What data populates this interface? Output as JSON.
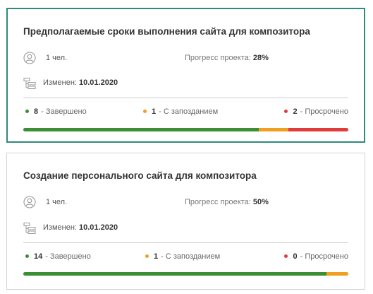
{
  "colors": {
    "done": "#3a8f35",
    "late": "#f0a020",
    "overdue": "#e03c3c",
    "accent_border": "#2e8b79"
  },
  "labels": {
    "progress": "Прогресс проекта:",
    "changed": "Изменен:",
    "done": "- Завершено",
    "late": "- С запозданием",
    "overdue": "- Просрочено"
  },
  "cards": [
    {
      "title": "Предполагаемые сроки выполнения сайта для композитора",
      "members": "1 чел.",
      "progress": "28%",
      "changed_date": "10.01.2020",
      "done_count": "8",
      "late_count": "1",
      "overdue_count": "2",
      "selected": true,
      "bar_fractions": {
        "done": 0.725,
        "late": 0.09,
        "overdue": 0.185
      }
    },
    {
      "title": "Создание персонального сайта для композитора",
      "members": "1 чел.",
      "progress": "50%",
      "changed_date": "10.01.2020",
      "done_count": "14",
      "late_count": "1",
      "overdue_count": "0",
      "selected": false,
      "bar_fractions": {
        "done": 0.933,
        "late": 0.067,
        "overdue": 0
      }
    }
  ]
}
